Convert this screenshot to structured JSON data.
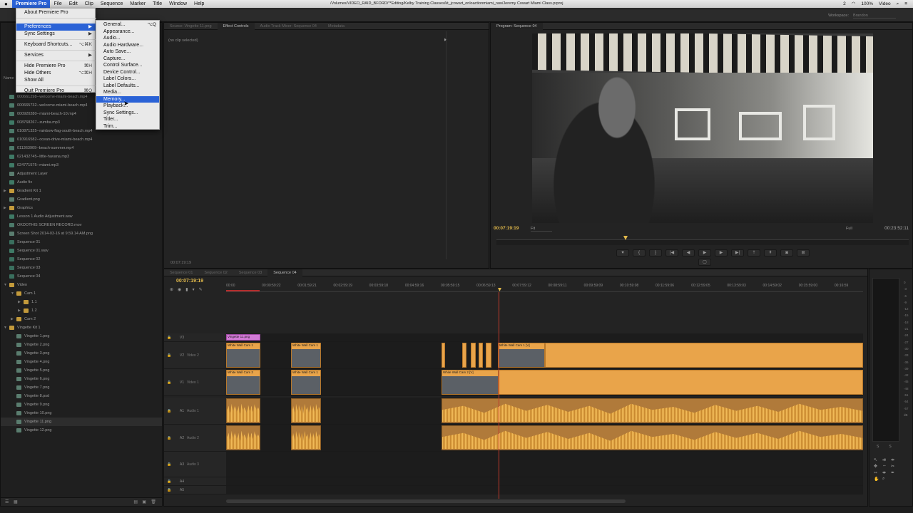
{
  "menubar": {
    "app": "Premiere Pro",
    "items": [
      "File",
      "Edit",
      "Clip",
      "Sequence",
      "Marker",
      "Title",
      "Window",
      "Help"
    ],
    "path": "/Volumes/VIDEO_RAID_BFORD/**Editing/Kelby Training Classes/kt_jcowart_onloactionmiami_raw/Jeremy Cowart Miami Class.prproj",
    "status_right": [
      "2",
      "100%",
      "Video"
    ]
  },
  "workspace": {
    "label": "Workspace:",
    "value": "Brandon"
  },
  "app_menu": {
    "items": [
      {
        "label": "About Premiere Pro",
        "shortcut": ""
      },
      {
        "label": "Preferences",
        "shortcut": "▶",
        "highlighted": true
      },
      {
        "label": "Sync Settings",
        "shortcut": "▶"
      },
      {
        "label": "Keyboard Shortcuts...",
        "shortcut": "⌥⌘K"
      },
      {
        "label": "Services",
        "shortcut": "▶"
      },
      {
        "label": "Hide Premiere Pro",
        "shortcut": "⌘H"
      },
      {
        "label": "Hide Others",
        "shortcut": "⌥⌘H"
      },
      {
        "label": "Show All",
        "shortcut": ""
      },
      {
        "label": "Quit Premiere Pro",
        "shortcut": "⌘Q"
      }
    ]
  },
  "pref_menu": {
    "items": [
      {
        "label": "General...",
        "shortcut": "⌥Q"
      },
      {
        "label": "Appearance...",
        "shortcut": ""
      },
      {
        "label": "Audio...",
        "shortcut": ""
      },
      {
        "label": "Audio Hardware...",
        "shortcut": ""
      },
      {
        "label": "Auto Save...",
        "shortcut": ""
      },
      {
        "label": "Capture...",
        "shortcut": ""
      },
      {
        "label": "Control Surface...",
        "shortcut": ""
      },
      {
        "label": "Device Control...",
        "shortcut": ""
      },
      {
        "label": "Label Colors...",
        "shortcut": ""
      },
      {
        "label": "Label Defaults...",
        "shortcut": ""
      },
      {
        "label": "Media...",
        "shortcut": ""
      },
      {
        "label": "Memory...",
        "shortcut": "",
        "highlighted": true
      },
      {
        "label": "Playback...",
        "shortcut": ""
      },
      {
        "label": "Sync Settings...",
        "shortcut": ""
      },
      {
        "label": "Titler...",
        "shortcut": ""
      },
      {
        "label": "Trim...",
        "shortcut": ""
      }
    ]
  },
  "source_panel": {
    "tabs": [
      "Source: Vingette 11.png",
      "Effect Controls",
      "Audio Track Mixer: Sequence 04",
      "Metadata"
    ],
    "no_clip": "(no clip selected)",
    "timecode": "00:07:19:19"
  },
  "program": {
    "tab": "Program: Sequence 04",
    "timecode": "00:07:19:19",
    "fit": "Fit",
    "quality": "Full",
    "duration": "00:23:52:11"
  },
  "project": {
    "header": "Name",
    "items": [
      {
        "label": "000661298--welcome-miami-beach.mp4",
        "icon": "vid",
        "indent": 0
      },
      {
        "label": "000665732--welcome-miami-beach.mp4",
        "icon": "vid",
        "indent": 0
      },
      {
        "label": "000920280--miami-beach-10.mp4",
        "icon": "vid",
        "indent": 0
      },
      {
        "label": "008768267--zumba.mp3",
        "icon": "aud",
        "indent": 0
      },
      {
        "label": "010871325--rainbow-flag-south-beach.mp4",
        "icon": "vid",
        "indent": 0
      },
      {
        "label": "010916582--ocean-drive-miami-beach.mp4",
        "icon": "vid",
        "indent": 0
      },
      {
        "label": "011363909--beach-summer.mp4",
        "icon": "vid",
        "indent": 0
      },
      {
        "label": "021432745--little-havana.mp3",
        "icon": "aud",
        "indent": 0
      },
      {
        "label": "024771575--miami.mp3",
        "icon": "aud",
        "indent": 0
      },
      {
        "label": "Adjustment Layer",
        "icon": "img",
        "indent": 0
      },
      {
        "label": "Audio fix",
        "icon": "aud",
        "indent": 0
      },
      {
        "label": "Gradient Kit 1",
        "icon": "fold",
        "indent": 0,
        "tri": "▶"
      },
      {
        "label": "Gradient.png",
        "icon": "img",
        "indent": 0
      },
      {
        "label": "Graphics",
        "icon": "fold",
        "indent": 0,
        "tri": "▶"
      },
      {
        "label": "Lesson 1 Audio Adjustment.wav",
        "icon": "aud",
        "indent": 0
      },
      {
        "label": "OKDOTHIS SCREEN RECORD.mov",
        "icon": "vid",
        "indent": 0
      },
      {
        "label": "Screen Shot 2014-03-16 at 9.59.14 AM.png",
        "icon": "img",
        "indent": 0
      },
      {
        "label": "Sequence 01",
        "icon": "seq",
        "indent": 0
      },
      {
        "label": "Sequence 01.wav",
        "icon": "aud",
        "indent": 0
      },
      {
        "label": "Sequence 02",
        "icon": "seq",
        "indent": 0
      },
      {
        "label": "Sequence 03",
        "icon": "seq",
        "indent": 0
      },
      {
        "label": "Sequence 04",
        "icon": "seq",
        "indent": 0
      },
      {
        "label": "Video",
        "icon": "fold",
        "indent": 0,
        "tri": "▼"
      },
      {
        "label": "Cam 1",
        "icon": "fold",
        "indent": 1,
        "tri": "▼"
      },
      {
        "label": "1.1",
        "icon": "fold",
        "indent": 2,
        "tri": "▶"
      },
      {
        "label": "1.2",
        "icon": "fold",
        "indent": 2,
        "tri": "▶"
      },
      {
        "label": "Cam 2",
        "icon": "fold",
        "indent": 1,
        "tri": "▶"
      },
      {
        "label": "Vingette Kit 1",
        "icon": "fold",
        "indent": 0,
        "tri": "▼"
      },
      {
        "label": "Vingette 1.png",
        "icon": "img",
        "indent": 1
      },
      {
        "label": "Vingette 2.png",
        "icon": "img",
        "indent": 1
      },
      {
        "label": "Vingette 3.png",
        "icon": "img",
        "indent": 1
      },
      {
        "label": "Vingette 4.png",
        "icon": "img",
        "indent": 1
      },
      {
        "label": "Vingette 5.png",
        "icon": "img",
        "indent": 1
      },
      {
        "label": "Vingette 6.png",
        "icon": "img",
        "indent": 1
      },
      {
        "label": "Vingette 7.png",
        "icon": "img",
        "indent": 1
      },
      {
        "label": "Vingette 8.psd",
        "icon": "img",
        "indent": 1
      },
      {
        "label": "Vingette 9.png",
        "icon": "img",
        "indent": 1
      },
      {
        "label": "Vingette 10.png",
        "icon": "img",
        "indent": 1
      },
      {
        "label": "Vingette 11.png",
        "icon": "img",
        "indent": 1,
        "selected": true
      },
      {
        "label": "Vingette 12.png",
        "icon": "img",
        "indent": 1
      }
    ]
  },
  "timeline": {
    "tabs": [
      "Sequence 01",
      "Sequence 02",
      "Sequence 03",
      "Sequence 04"
    ],
    "timecode": "00:07:19:19",
    "ruler": [
      "00:00",
      "00:00:59:22",
      "00:01:59:21",
      "00:02:59:19",
      "00:03:59:18",
      "00:04:59:16",
      "00:05:59:15",
      "00:06:59:13",
      "00:07:59:12",
      "00:08:59:11",
      "00:09:59:09",
      "00:10:59:08",
      "00:11:59:06",
      "00:12:59:05",
      "00:13:59:03",
      "00:14:59:02",
      "00:15:59:00",
      "00:16:59"
    ],
    "tracks": {
      "v3": {
        "label": "V3",
        "name": ""
      },
      "v2": {
        "label": "V2",
        "name": "Video 2"
      },
      "v1": {
        "label": "V1",
        "name": "Video 1"
      },
      "a1": {
        "label": "A1",
        "name": "Audio 1"
      },
      "a2": {
        "label": "A2",
        "name": "Audio 2"
      },
      "a3": {
        "label": "A3",
        "name": "Audio 3"
      },
      "a4": {
        "label": "A4",
        "name": ""
      },
      "a5": {
        "label": "A5",
        "name": ""
      }
    },
    "clips": {
      "vingette": "Vingette 11.png",
      "cam1": "White Wall Cam 1",
      "cam2": "White Wall Cam 2",
      "cam1b": "White Wall Cam 1 [V]",
      "cam2b": "White Wall Cam 2 [V]"
    }
  },
  "meters": {
    "scale": [
      "0",
      "-3",
      "-6",
      "-9",
      "-12",
      "-15",
      "-18",
      "-21",
      "-24",
      "-27",
      "-30",
      "-33",
      "-36",
      "-39",
      "-42",
      "-45",
      "-48",
      "-51",
      "-54",
      "-57",
      "dB"
    ],
    "solo": [
      "S",
      "S"
    ]
  },
  "colors": {
    "accent": "#e2b94a",
    "clip": "#e9a44a",
    "menu_highlight": "#2a62d6",
    "vignette_clip": "#d27ad6"
  }
}
